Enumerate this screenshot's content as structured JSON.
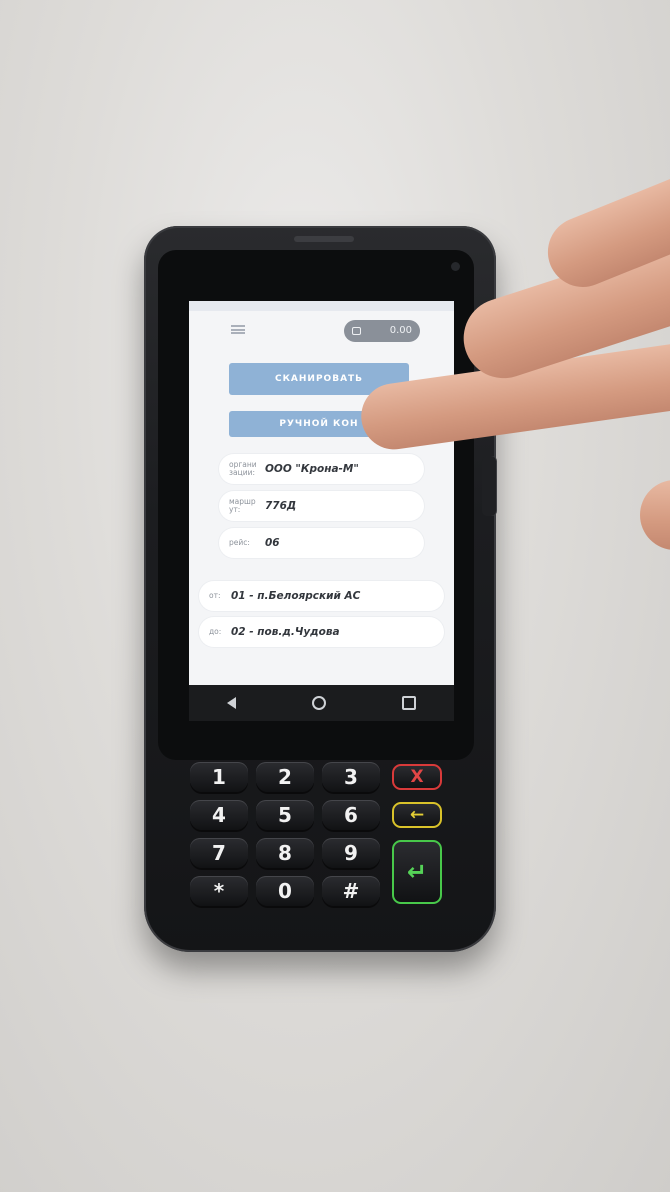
{
  "statusbar": {},
  "header": {
    "menu_icon": "hamburger-icon",
    "balance_icon": "wallet-icon",
    "balance_value": "0.00"
  },
  "actions": {
    "scan_label": "СКАНИРОВАТЬ",
    "manual_label": "РУЧНОЙ КОН"
  },
  "trip_info": {
    "organization": {
      "label": "органи\nзации:",
      "value": "ООО \"Крона-М\""
    },
    "route": {
      "label": "маршр\nут:",
      "value": "776Д"
    },
    "run": {
      "label": "рейс:",
      "value": "06"
    },
    "from": {
      "label": "от:",
      "value": "01 - п.Белоярский АС"
    },
    "to": {
      "label": "до:",
      "value": "02 - пов.д.Чудова"
    }
  },
  "navbar": {
    "back_icon": "back-triangle-icon",
    "home_icon": "home-circle-icon",
    "recent_icon": "recent-square-icon"
  },
  "keypad": {
    "keys": [
      "1",
      "2",
      "3",
      "4",
      "5",
      "6",
      "7",
      "8",
      "9",
      "*",
      "0",
      "#"
    ],
    "cancel_label": "X",
    "backspace_label": "←",
    "enter_label": "↵",
    "colors": {
      "cancel": "#d93a3a",
      "backspace": "#d9c22a",
      "enter": "#48c84a"
    }
  }
}
